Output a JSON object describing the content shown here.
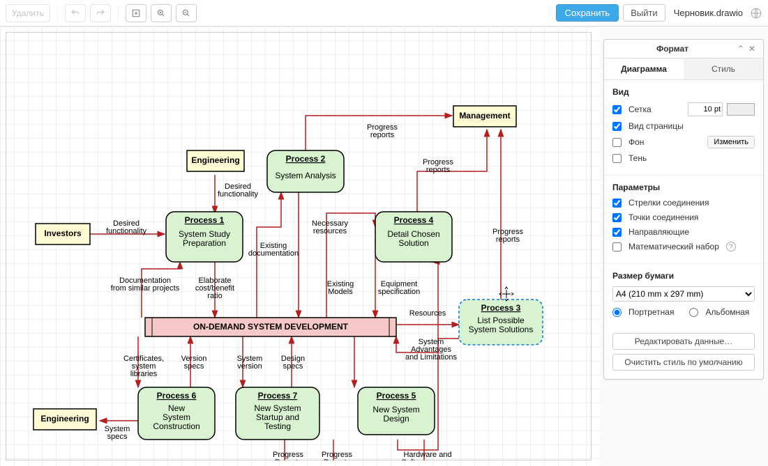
{
  "toolbar": {
    "delete": "Удалить",
    "save": "Сохранить",
    "exit": "Выйти",
    "filename": "Черновик.drawio"
  },
  "panel": {
    "title": "Формат",
    "tab_diagram": "Диаграмма",
    "tab_style": "Стиль",
    "s_view": "Вид",
    "grid": "Сетка",
    "grid_size": "10 pt",
    "page_view": "Вид страницы",
    "background": "Фон",
    "change": "Изменить",
    "shadow": "Тень",
    "s_params": "Параметры",
    "conn_arrows": "Стрелки соединения",
    "conn_points": "Точки соединения",
    "guides": "Направляющие",
    "math": "Математический набор",
    "s_paper": "Размер бумаги",
    "paper_value": "A4 (210 mm x 297 mm)",
    "orient_portrait": "Портретная",
    "orient_landscape": "Альбомная",
    "edit_data": "Редактировать данные…",
    "clear_style": "Очистить стиль по умолчанию"
  },
  "diagram": {
    "nodes": {
      "investors": "Investors",
      "engineering1": "Engineering",
      "engineering2": "Engineering",
      "management": "Management",
      "p1_t": "Process 1",
      "p1_b": "System Study Preparation",
      "p2_t": "Process 2",
      "p2_b": "System Analysis",
      "p3_t": "Process 3",
      "p3_b": "List Possible System Solutions",
      "p4_t": "Process 4",
      "p4_b": "Detail Chosen Solution",
      "p5_t": "Process 5",
      "p5_b": "New System Design",
      "p6_t": "Process 6",
      "p6_b": "New System Construction",
      "p7_t": "Process 7",
      "p7_b": "New System Startup and Testing",
      "main": "ON-DEMAND SYSTEM DEVELOPMENT"
    },
    "edges": {
      "e1": "Desired functionality",
      "e2": "Desired functionality",
      "e3": "Documentation from similar projects",
      "e4": "Elaborate cost/benefit ratio",
      "e5": "Existing documentation",
      "e6": "Necessary resources",
      "e7": "Progress reports",
      "e8": "Progress reports",
      "e9": "Progress reports",
      "e10": "Existing Models",
      "e11": "Equipment specification",
      "e12": "Resources",
      "e13": "System Advantages and Limitations",
      "e14": "Certificates, system libraries",
      "e15": "Version specs",
      "e16": "System version",
      "e17": "Design specs",
      "e18": "System specs",
      "e19": "Progress Reports",
      "e20": "Progress Reports",
      "e21": "Hardware and Software specs"
    }
  }
}
